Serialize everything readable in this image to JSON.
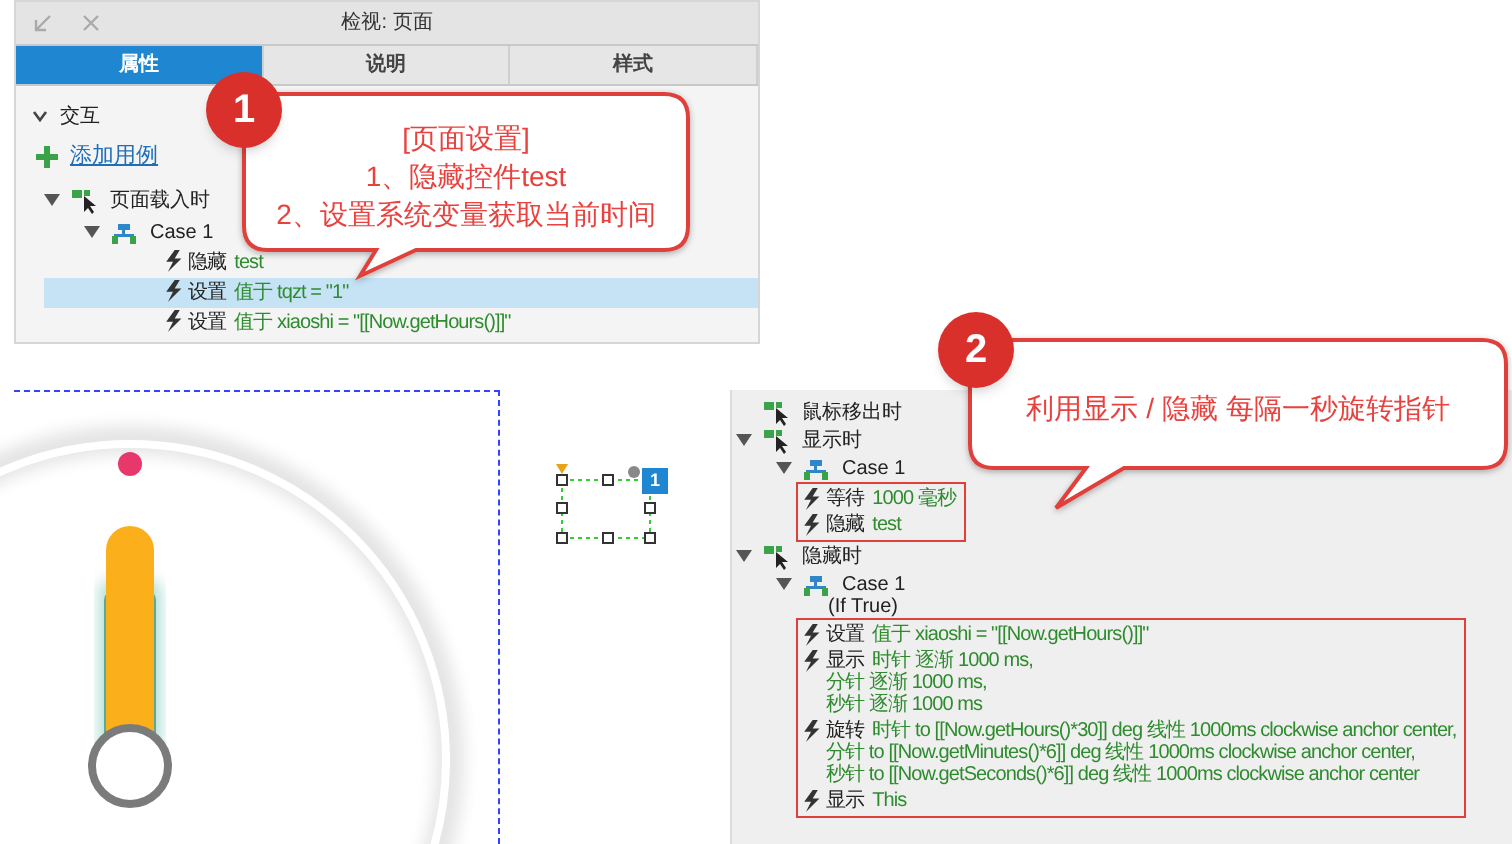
{
  "inspector": {
    "title": "检视: 页面",
    "tabs": [
      {
        "label": "属性",
        "selected": true
      },
      {
        "label": "说明",
        "selected": false
      },
      {
        "label": "样式",
        "selected": false
      }
    ],
    "section": {
      "label": "交互",
      "expanded": true
    },
    "add_case_link": "添加用例",
    "events": [
      {
        "label": "页面载入时",
        "expanded": true,
        "cases": [
          {
            "label": "Case 1",
            "expanded": true,
            "actions": [
              {
                "verb": "隐藏",
                "lines": [
                  "test"
                ],
                "selected": false
              },
              {
                "verb": "设置",
                "lines": [
                  "值于 tqzt = \"1\""
                ],
                "selected": true
              },
              {
                "verb": "设置",
                "lines": [
                  "值于 xiaoshi = \"[[Now.getHours()]]\""
                ],
                "selected": false
              }
            ]
          }
        ]
      }
    ]
  },
  "callouts": [
    {
      "number": "1",
      "lines": [
        "[页面设置]",
        "1、隐藏控件test",
        "2、设置系统变量获取当前时间"
      ]
    },
    {
      "number": "2",
      "lines": [
        "利用显示 / 隐藏 每隔一秒旋转指针"
      ]
    }
  ],
  "canvas": {
    "selection_badge": "1"
  },
  "interactions_panel": {
    "events": [
      {
        "label": "鼠标移出时"
      },
      {
        "label": "显示时",
        "expanded": true,
        "cases": [
          {
            "label": "Case 1",
            "expanded": true,
            "highlighted": true,
            "actions": [
              {
                "verb": "等待",
                "lines": [
                  "1000 毫秒"
                ]
              },
              {
                "verb": "隐藏",
                "lines": [
                  "test"
                ]
              }
            ]
          }
        ]
      },
      {
        "label": "隐藏时",
        "expanded": true,
        "cases": [
          {
            "label": "Case 1",
            "condition": "(If True)",
            "expanded": true,
            "highlighted": true,
            "actions": [
              {
                "verb": "设置",
                "lines": [
                  "值于 xiaoshi = \"[[Now.getHours()]]\""
                ]
              },
              {
                "verb": "显示",
                "lines": [
                  "时针 逐渐 1000 ms,",
                  "分针 逐渐 1000 ms,",
                  "秒针 逐渐 1000 ms"
                ]
              },
              {
                "verb": "旋转",
                "lines": [
                  "时针 to [[Now.getHours()*30]] deg 线性 1000ms clockwise anchor center,",
                  "分针 to [[Now.getMinutes()*6]] deg 线性 1000ms clockwise anchor center,",
                  "秒针 to [[Now.getSeconds()*6]] deg 线性 1000ms clockwise anchor center"
                ]
              },
              {
                "verb": "显示",
                "lines": [
                  "This"
                ]
              }
            ]
          }
        ]
      }
    ]
  }
}
